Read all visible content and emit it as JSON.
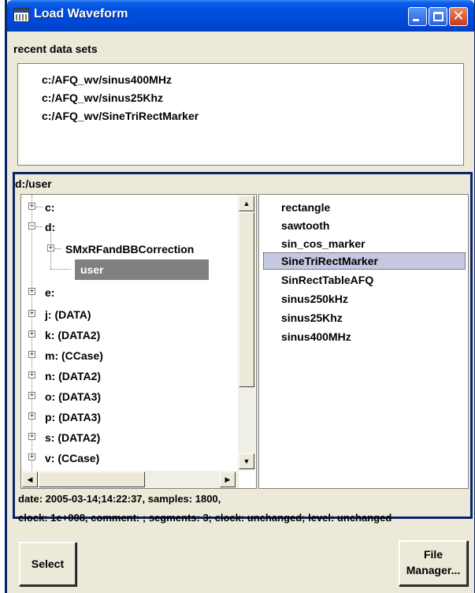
{
  "window": {
    "title": "Load Waveform",
    "icon": "waveform-window-icon",
    "controls": [
      "minimize-icon",
      "maximize-icon",
      "close-icon"
    ]
  },
  "recent": {
    "label": "recent data sets",
    "items": [
      "c:/AFQ_wv/sinus400MHz",
      "c:/AFQ_wv/sinus25Khz",
      "c:/AFQ_wv/SineTriRectMarker"
    ]
  },
  "browser": {
    "path": "d:/user",
    "tree": [
      {
        "label": "c:",
        "expander": "+"
      },
      {
        "label": "d:",
        "expander": "-"
      },
      {
        "label": "SMxRFandBBCorrection",
        "expander": "+"
      },
      {
        "label": "user",
        "selected": true
      },
      {
        "label": "e:",
        "expander": "+"
      },
      {
        "label": "j: (DATA)",
        "expander": "+"
      },
      {
        "label": "k: (DATA2)",
        "expander": "+"
      },
      {
        "label": "m: (CCase)",
        "expander": "+"
      },
      {
        "label": "n: (DATA2)",
        "expander": "+"
      },
      {
        "label": "o: (DATA3)",
        "expander": "+"
      },
      {
        "label": "p: (DATA3)",
        "expander": "+"
      },
      {
        "label": "s: (DATA2)",
        "expander": "+"
      },
      {
        "label": "v: (CCase)",
        "expander": "+"
      }
    ],
    "files": [
      "rectangle",
      "sawtooth",
      "sin_cos_marker",
      "SineTriRectMarker",
      "SinRectTableAFQ",
      "sinus250kHz",
      "sinus25Khz",
      "sinus400MHz"
    ],
    "selected_file": "SineTriRectMarker"
  },
  "info": {
    "line1": "date: 2005-03-14;14:22:37, samples: 1800,",
    "line2": "clock: 1e+008, comment: ; segments: 3; clock: unchanged; level: unchanged"
  },
  "buttons": {
    "select": "Select",
    "file_manager_line1": "File",
    "file_manager_line2": "Manager..."
  },
  "colors": {
    "title_bar": "#0048d8",
    "frame": "#0a246a",
    "selection_tree": "#808080",
    "selection_file": "#c6c7e0"
  }
}
